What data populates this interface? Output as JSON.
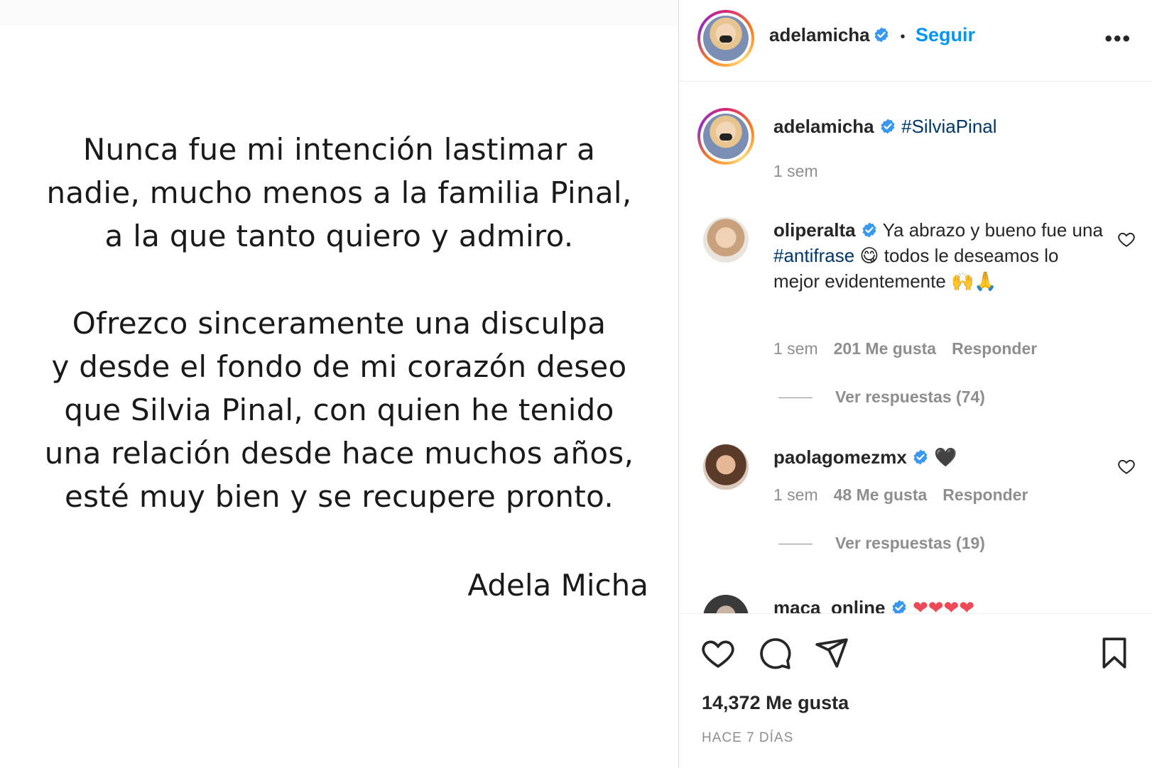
{
  "post": {
    "paragraph_1": "Nunca fue mi intención lastimar a nadie, mucho menos a la familia Pinal, a la que tanto quiero y admiro.",
    "paragraph_1_lines": [
      "Nunca fue mi intención lastimar a",
      "nadie, mucho menos a la familia Pinal,",
      "a la que tanto quiero y admiro."
    ],
    "paragraph_2_lines": [
      "Ofrezco sinceramente una disculpa",
      "y desde el fondo de mi corazón deseo",
      "que Silvia Pinal, con quien he tenido",
      "una relación desde hace muchos años,",
      "esté muy bien y se recupere pronto."
    ],
    "signature": "Adela Micha"
  },
  "header": {
    "username": "adelamicha",
    "separator": "•",
    "follow_label": "Seguir",
    "more_label": "•••"
  },
  "caption": {
    "username": "adelamicha",
    "hashtag": "#SilviaPinal",
    "time": "1 sem"
  },
  "comments": [
    {
      "username": "oliperalta",
      "text_before": "Ya abrazo y bueno fue una ",
      "hashtag": "#antifrase",
      "text_after": " 😋 todos le deseamos lo mejor evidentemente 🙌🙏",
      "time": "1 sem",
      "likes": "201 Me gusta",
      "reply_label": "Responder",
      "view_replies": "Ver respuestas (74)"
    },
    {
      "username": "paolagomezmx",
      "text": "🖤",
      "time": "1 sem",
      "likes": "48 Me gusta",
      "reply_label": "Responder",
      "view_replies": "Ver respuestas (19)"
    },
    {
      "username": "maca_online",
      "text": "❤❤❤❤"
    }
  ],
  "footer": {
    "likes": "14,372 Me gusta",
    "time": "HACE 7 DÍAS"
  },
  "colors": {
    "link_blue": "#0095f6",
    "hashtag_blue": "#00376b",
    "verified_blue": "#3897f0",
    "muted": "#8e8e8e"
  }
}
